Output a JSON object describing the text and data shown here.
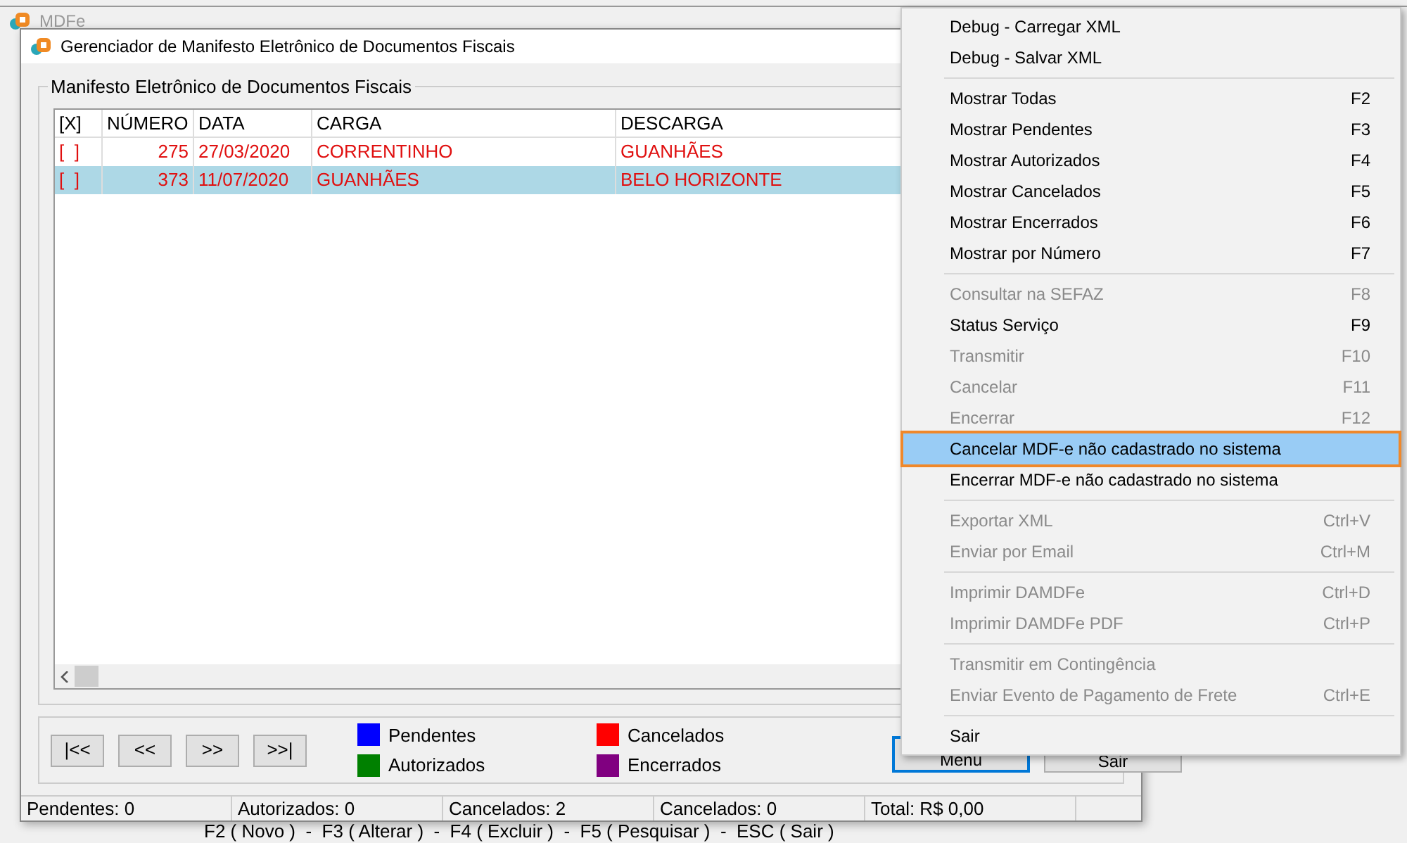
{
  "app_window": {
    "title": "MDFe",
    "hint": "F2 ( Novo )  -  F3 ( Alterar )  -  F4 ( Excluir )  -  F5 ( Pesquisar )  -  ESC ( Sair )"
  },
  "dialog": {
    "title": "Gerenciador de Manifesto Eletrônico de Documentos Fiscais",
    "group_title": "Manifesto Eletrônico de Documentos Fiscais",
    "table": {
      "columns": [
        "[X]",
        "NÚMERO",
        "DATA",
        "CARGA",
        "DESCARGA"
      ],
      "rows": [
        {
          "check": "[  ]",
          "numero": "275",
          "data": "27/03/2020",
          "carga": "CORRENTINHO",
          "descarga": "GUANHÃES",
          "selected": false
        },
        {
          "check": "[  ]",
          "numero": "373",
          "data": "11/07/2020",
          "carga": "GUANHÃES",
          "descarga": "BELO HORIZONTE",
          "selected": true
        }
      ]
    },
    "nav_buttons": [
      "|<<",
      "<<",
      ">>",
      ">>|"
    ],
    "legend": [
      {
        "label": "Pendentes",
        "color": "#0000ff"
      },
      {
        "label": "Autorizados",
        "color": "#008000"
      },
      {
        "label": "Cancelados",
        "color": "#ff0000"
      },
      {
        "label": "Encerrados",
        "color": "#800080"
      }
    ],
    "buttons": [
      {
        "label": "Menu",
        "focused": true
      },
      {
        "label": "Sair",
        "focused": false
      }
    ],
    "status_bar": [
      "Pendentes: 0",
      "Autorizados: 0",
      "Cancelados: 2",
      "Cancelados: 0",
      "Total: R$ 0,00"
    ]
  },
  "context_menu": [
    {
      "kind": "item",
      "label": "Debug - Carregar XML",
      "disabled": false,
      "selected": false
    },
    {
      "kind": "item",
      "label": "Debug - Salvar XML",
      "disabled": false,
      "selected": false
    },
    {
      "kind": "separator"
    },
    {
      "kind": "item",
      "label": "Mostrar Todas",
      "shortcut": "F2",
      "disabled": false,
      "selected": false
    },
    {
      "kind": "item",
      "label": "Mostrar Pendentes",
      "shortcut": "F3",
      "disabled": false,
      "selected": false
    },
    {
      "kind": "item",
      "label": "Mostrar Autorizados",
      "shortcut": "F4",
      "disabled": false,
      "selected": false
    },
    {
      "kind": "item",
      "label": "Mostrar Cancelados",
      "shortcut": "F5",
      "disabled": false,
      "selected": false
    },
    {
      "kind": "item",
      "label": "Mostrar Encerrados",
      "shortcut": "F6",
      "disabled": false,
      "selected": false
    },
    {
      "kind": "item",
      "label": "Mostrar por Número",
      "shortcut": "F7",
      "disabled": false,
      "selected": false
    },
    {
      "kind": "separator"
    },
    {
      "kind": "item",
      "label": "Consultar na SEFAZ",
      "shortcut": "F8",
      "disabled": true,
      "selected": false
    },
    {
      "kind": "item",
      "label": "Status Serviço",
      "shortcut": "F9",
      "disabled": false,
      "selected": false
    },
    {
      "kind": "item",
      "label": "Transmitir",
      "shortcut": "F10",
      "disabled": true,
      "selected": false
    },
    {
      "kind": "item",
      "label": "Cancelar",
      "shortcut": "F11",
      "disabled": true,
      "selected": false
    },
    {
      "kind": "item",
      "label": "Encerrar",
      "shortcut": "F12",
      "disabled": true,
      "selected": false
    },
    {
      "kind": "item",
      "label": "Cancelar MDF-e não cadastrado no sistema",
      "disabled": false,
      "selected": true
    },
    {
      "kind": "item",
      "label": "Encerrar MDF-e não cadastrado no sistema",
      "disabled": false,
      "selected": false
    },
    {
      "kind": "separator"
    },
    {
      "kind": "item",
      "label": "Exportar XML",
      "shortcut": "Ctrl+V",
      "disabled": true,
      "selected": false
    },
    {
      "kind": "item",
      "label": "Enviar por Email",
      "shortcut": "Ctrl+M",
      "disabled": true,
      "selected": false
    },
    {
      "kind": "separator"
    },
    {
      "kind": "item",
      "label": "Imprimir DAMDFe",
      "shortcut": "Ctrl+D",
      "disabled": true,
      "selected": false
    },
    {
      "kind": "item",
      "label": "Imprimir DAMDFe PDF",
      "shortcut": "Ctrl+P",
      "disabled": true,
      "selected": false
    },
    {
      "kind": "separator"
    },
    {
      "kind": "item",
      "label": "Transmitir em Contingência",
      "disabled": true,
      "selected": false
    },
    {
      "kind": "item",
      "label": "Enviar Evento de Pagamento de Frete",
      "shortcut": "Ctrl+E",
      "disabled": true,
      "selected": false
    },
    {
      "kind": "separator"
    },
    {
      "kind": "item",
      "label": "Sair",
      "disabled": false,
      "selected": false
    }
  ]
}
